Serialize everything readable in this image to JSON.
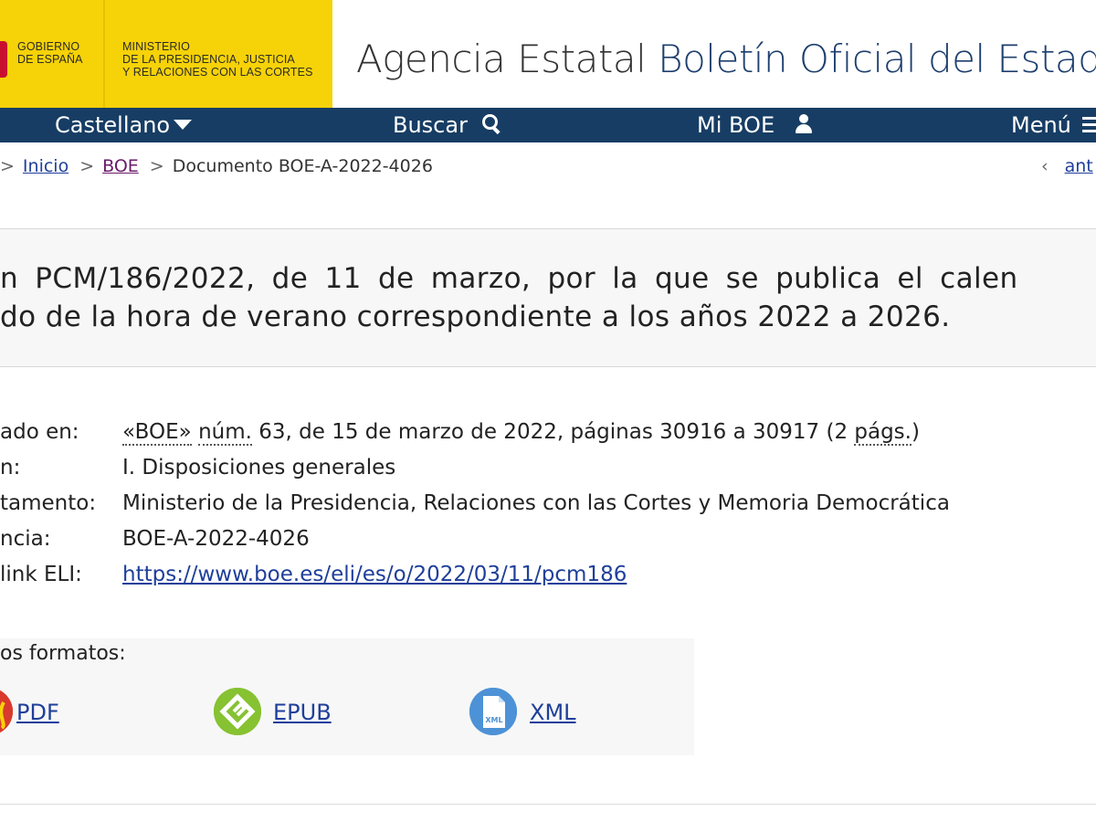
{
  "header": {
    "gov_name": "GOBIERNO\nDE ESPAÑA",
    "ministry_name": "MINISTERIO\nDE LA PRESIDENCIA, JUSTICIA\nY RELACIONES CON LAS CORTES",
    "site_title_prefix": "Agencia Estatal",
    "site_title_accent": "Boletín Oficial del Estado",
    "logo_color": "#f6d208"
  },
  "nav": {
    "background": "#173d64",
    "language_label": "Castellano",
    "search_label": "Buscar",
    "myboe_label": "Mi BOE",
    "menu_label": "Menú"
  },
  "breadcrumb": {
    "home": "Inicio",
    "boe": "BOE",
    "current": "Documento BOE-A-2022-4026",
    "prev_chevron": "‹",
    "prev_label": "ant"
  },
  "document": {
    "title_line1": "n PCM/186/2022, de 11 de marzo, por la que se publica el calen",
    "title_line2": "do de la hora de verano correspondiente a los años 2022 a 2026."
  },
  "metadata": {
    "published_label": "ado en:",
    "published_boe": "«BOE»",
    "published_num_abbr": "núm.",
    "published_rest": " 63, de 15 de marzo de 2022, páginas 30916 a 30917 (2 ",
    "published_pags_abbr": "págs.",
    "published_close": ")",
    "section_label": "n:",
    "section_value": "I. Disposiciones generales",
    "department_label": "tamento:",
    "department_value": "Ministerio de la Presidencia, Relaciones con las Cortes y Memoria Democrática",
    "reference_label": "ncia:",
    "reference_value": "BOE-A-2022-4026",
    "eli_label": "link ELI:",
    "eli_value": "https://www.boe.es/eli/es/o/2022/03/11/pcm186"
  },
  "formats": {
    "label": "os formatos:",
    "pdf": "PDF",
    "epub": "EPUB",
    "xml": "XML",
    "xml_icon_text": "XML"
  }
}
